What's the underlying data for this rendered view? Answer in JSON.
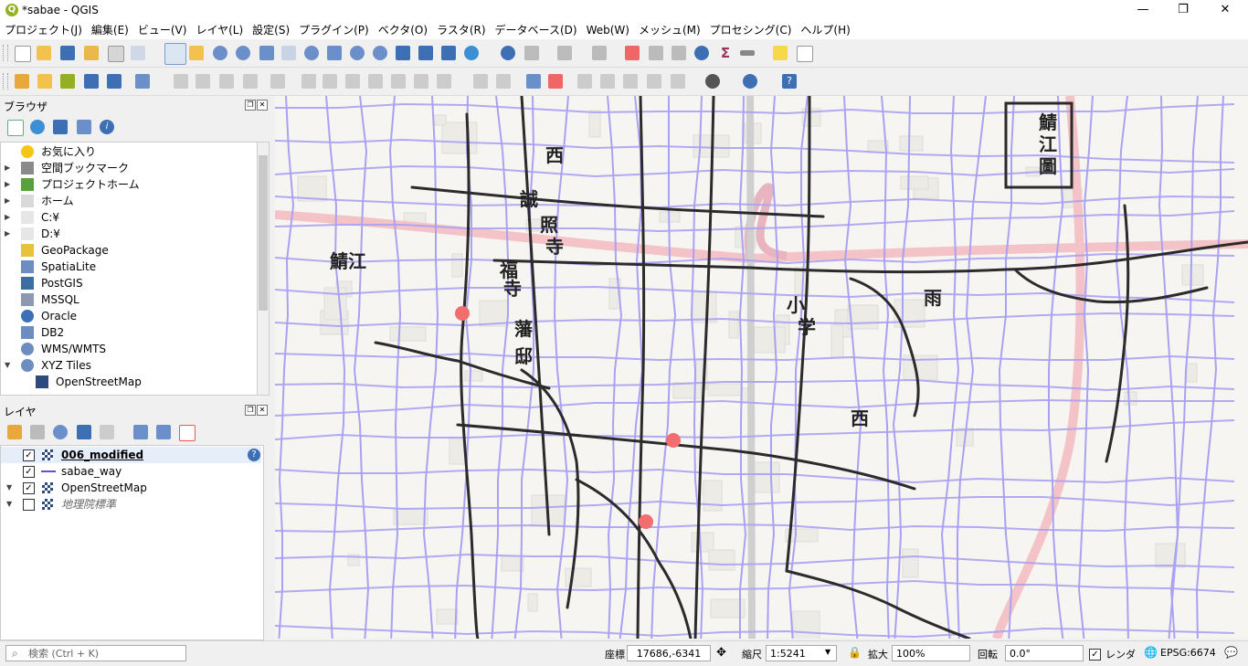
{
  "window": {
    "title": "*sabae - QGIS",
    "controls": [
      "—",
      "❐",
      "✕"
    ]
  },
  "menu": [
    "プロジェクト(J)",
    "編集(E)",
    "ビュー(V)",
    "レイヤ(L)",
    "設定(S)",
    "プラグイン(P)",
    "ベクタ(O)",
    "ラスタ(R)",
    "データベース(D)",
    "Web(W)",
    "メッシュ(M)",
    "プロセシング(C)",
    "ヘルプ(H)"
  ],
  "browser": {
    "title": "ブラウザ",
    "items": [
      {
        "label": "お気に入り",
        "icon": "star-icon",
        "expandable": false
      },
      {
        "label": "空間ブックマーク",
        "icon": "bookmark-icon",
        "expandable": true
      },
      {
        "label": "プロジェクトホーム",
        "icon": "project-home-icon",
        "expandable": true
      },
      {
        "label": "ホーム",
        "icon": "home-folder-icon",
        "expandable": true
      },
      {
        "label": "C:¥",
        "icon": "drive-icon",
        "expandable": true
      },
      {
        "label": "D:¥",
        "icon": "drive-icon",
        "expandable": true
      },
      {
        "label": "GeoPackage",
        "icon": "geopackage-icon",
        "expandable": false
      },
      {
        "label": "SpatiaLite",
        "icon": "spatialite-icon",
        "expandable": false
      },
      {
        "label": "PostGIS",
        "icon": "postgis-icon",
        "expandable": false
      },
      {
        "label": "MSSQL",
        "icon": "mssql-icon",
        "expandable": false
      },
      {
        "label": "Oracle",
        "icon": "oracle-icon",
        "expandable": false
      },
      {
        "label": "DB2",
        "icon": "db2-icon",
        "expandable": false
      },
      {
        "label": "WMS/WMTS",
        "icon": "wms-icon",
        "expandable": false
      },
      {
        "label": "XYZ Tiles",
        "icon": "xyz-tiles-icon",
        "expandable": true,
        "expanded": true
      },
      {
        "label": "OpenStreetMap",
        "icon": "raster-tile-icon",
        "child": true
      }
    ]
  },
  "layers": {
    "title": "レイヤ",
    "items": [
      {
        "label": "006_modified",
        "checked": true,
        "icon": "raster-icon",
        "bold": true,
        "selected": true,
        "warning": "?"
      },
      {
        "label": "sabae_way",
        "checked": true,
        "icon": "line-layer-icon"
      },
      {
        "label": "OpenStreetMap",
        "checked": true,
        "icon": "raster-icon",
        "expandable": true
      },
      {
        "label": "地理院標準",
        "checked": false,
        "icon": "raster-icon",
        "expandable": true,
        "italic": true
      }
    ]
  },
  "statusbar": {
    "search_placeholder": "検索 (Ctrl + K)",
    "coord_label": "座標",
    "coord_value": "17686,-6341",
    "scale_label": "縮尺",
    "scale_value": "1:5241",
    "magnifier_label": "拡大",
    "magnifier_value": "100%",
    "rotation_label": "回転",
    "rotation_value": "0.0°",
    "render_label": "レンダ",
    "crs_label": "EPSG:6674"
  },
  "map": {
    "labels": [
      "誠",
      "照",
      "寺",
      "西",
      "福",
      "寺",
      "藩",
      "邸",
      "鯖",
      "江",
      "圖",
      "雨",
      "小",
      "学",
      "西",
      "鯖江"
    ]
  }
}
